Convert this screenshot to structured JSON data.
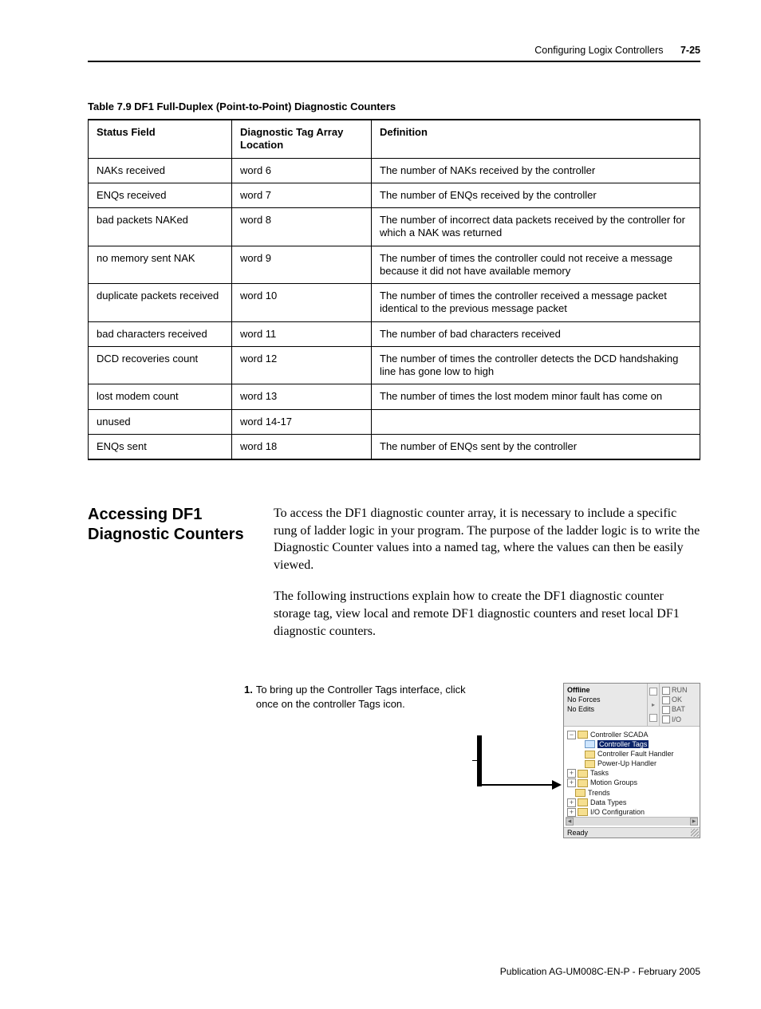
{
  "header": {
    "section": "Configuring Logix Controllers",
    "page": "7-25"
  },
  "table": {
    "caption": "Table 7.9  DF1 Full-Duplex (Point-to-Point) Diagnostic Counters",
    "columns": [
      "Status Field",
      "Diagnostic Tag Array Location",
      "Definition"
    ],
    "rows": [
      {
        "status": "NAKs received",
        "loc": "word 6",
        "def": "The number of NAKs received by the controller"
      },
      {
        "status": "ENQs received",
        "loc": "word 7",
        "def": "The number of ENQs received by the controller"
      },
      {
        "status": "bad packets NAKed",
        "loc": "word 8",
        "def": "The number of incorrect data packets received by the controller for which a NAK was returned"
      },
      {
        "status": "no memory sent NAK",
        "loc": "word 9",
        "def": "The number of times the controller could not receive a message because it did not have available memory"
      },
      {
        "status": "duplicate packets received",
        "loc": "word 10",
        "def": "The number of times the controller received a message packet identical to the previous message packet"
      },
      {
        "status": "bad characters received",
        "loc": "word 11",
        "def": "The number of bad characters received"
      },
      {
        "status": "DCD recoveries count",
        "loc": "word 12",
        "def": "The number of times the controller detects the DCD handshaking line has gone low to high"
      },
      {
        "status": "lost modem count",
        "loc": "word 13",
        "def": "The number of times the lost modem minor fault has come on"
      },
      {
        "status": "unused",
        "loc": "word 14-17",
        "def": ""
      },
      {
        "status": "ENQs sent",
        "loc": "word 18",
        "def": "The number of ENQs sent by the controller"
      }
    ]
  },
  "section": {
    "heading": "Accessing DF1 Diagnostic Counters",
    "p1": "To access the DF1 diagnostic counter array, it is necessary to include a specific rung of ladder logic in your program. The purpose of the ladder logic is to write the Diagnostic Counter values into a named tag, where the values can then be easily viewed.",
    "p2": "The following instructions explain how to create the DF1 diagnostic counter storage tag, view local and remote DF1 diagnostic counters and reset local DF1 diagnostic counters."
  },
  "step": {
    "num": "1.",
    "text": "To bring up the Controller Tags interface, click once on the controller Tags icon."
  },
  "app": {
    "offline": "Offline",
    "no_forces": "No Forces",
    "no_edits": "No Edits",
    "run": "RUN",
    "ok": "OK",
    "bat": "BAT",
    "io": "I/O",
    "tree": {
      "root": "Controller SCADA",
      "tags": "Controller Tags",
      "fault": "Controller Fault Handler",
      "power": "Power-Up Handler",
      "tasks": "Tasks",
      "motion": "Motion Groups",
      "trends": "Trends",
      "data": "Data Types",
      "ioconf": "I/O Configuration"
    },
    "status": "Ready"
  },
  "footer": "Publication AG-UM008C-EN-P - February 2005"
}
